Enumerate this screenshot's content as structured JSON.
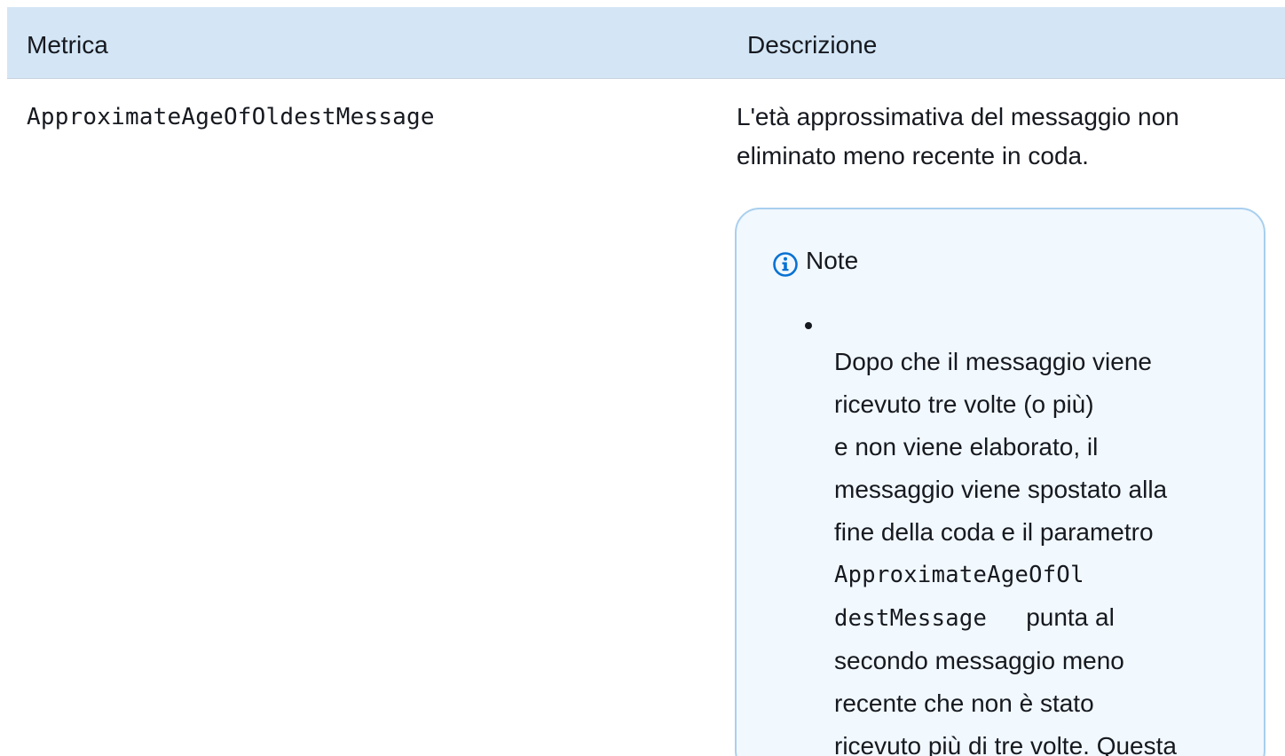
{
  "table": {
    "header": {
      "metric": "Metrica",
      "description": "Descrizione"
    },
    "row": {
      "metric": "ApproximateAgeOfOldestMessage",
      "description_lines": [
        "L'età approssimativa del messaggio non",
        "eliminato meno recente in coda."
      ],
      "note": {
        "icon": "info-icon",
        "title": "Note",
        "lines": [
          "Dopo che il messaggio viene",
          "ricevuto tre volte (o più)",
          "e non viene elaborato, il",
          "messaggio viene spostato alla",
          "fine della coda e il parametro"
        ],
        "code_line_1": "ApproximateAgeOfOl",
        "code_line_2": "destMessage",
        "after_code": "punta al",
        "lines_after": [
          "secondo messaggio meno",
          "recente che non è stato",
          "ricevuto più di tre volte. Questa"
        ]
      }
    }
  },
  "colors": {
    "header_background": "#d4e6f6",
    "note_border": "#a9cfee",
    "note_background": "#f1f8fe",
    "info_icon": "#0972d3",
    "text": "#16191f"
  }
}
